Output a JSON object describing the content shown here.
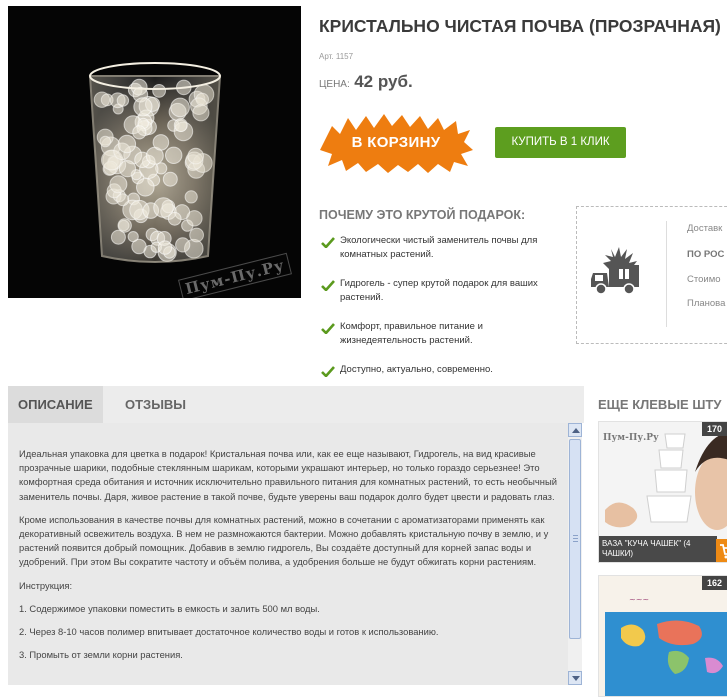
{
  "product": {
    "title": "КРИСТАЛЬНО ЧИСТАЯ ПОЧВА (ПРОЗРАЧНАЯ)",
    "article": "Арт. 1157",
    "price_label": "ЦЕНА:",
    "price_value": "42 руб.",
    "watermark": "Пум-Пу.Ру"
  },
  "actions": {
    "cart_label": "В КОРЗИНУ",
    "buy_one_click_label": "КУПИТЬ В 1 КЛИК"
  },
  "why": {
    "heading": "ПОЧЕМУ ЭТО КРУТОЙ ПОДАРОК:",
    "items": [
      "Экологически чистый заменитель почвы для комнатных растений.",
      "Гидрогель - супер крутой подарок для ваших растений.",
      "Комфорт, правильное питание и жизнедеятельность растений.",
      "Доступно, актуально, современно."
    ]
  },
  "delivery": {
    "lines": [
      "Доставк",
      "ПО РОС",
      "Стоимо",
      "Планова"
    ]
  },
  "tabs": [
    {
      "label": "ОПИСАНИЕ",
      "active": true
    },
    {
      "label": "ОТЗЫВЫ",
      "active": false
    }
  ],
  "description": {
    "paragraphs": [
      "Идеальная упаковка для цветка в подарок! Кристальная почва или, как ее еще называют, Гидрогель, на вид красивые прозрачные шарики, подобные стеклянным шарикам, которыми украшают интерьер, но только гораздо серьезнее! Это комфортная среда обитания и источник исключительно правильного питания для комнатных растений, то есть необычный заменитель почвы.  Даря, живое растение в такой почве, будьте уверены ваш подарок долго будет цвести и радовать глаз.",
      "Кроме использования в качестве почвы для комнатных растений, можно в сочетании с ароматизаторами применять как декоративный освежитель воздуха. В нем не размножаются бактерии. Можно добавлять кристальную почву в землю, и у растений появится добрый помощник. Добавив в землю гидрогель, Вы создаёте доступный для корней запас воды и удобрений. При этом Вы сократите частоту и объём полива, а удобрения больше не будут обжигать корни растениям.",
      "Инструкция:",
      "1. Содержимое упаковки поместить в емкость и залить 500 мл воды.",
      "2. Через 8-10 часов полимер впитывает достаточное количество воды и готов к использованию.",
      "3. Промыть от земли корни растения."
    ]
  },
  "more": {
    "heading": "ЕЩЕ КЛЕВЫЕ ШТУ",
    "items": [
      {
        "name": "ВАЗА \"КУЧА ЧАШЕК\" (4 ЧАШКИ)",
        "count": "170",
        "watermark": "Пум-Пу.Ру"
      },
      {
        "name": "",
        "count": "162",
        "watermark": ""
      }
    ]
  },
  "colors": {
    "cart_orange": "#ee7d10",
    "buy_green": "#5d9e1f",
    "check_green": "#5b9a1e"
  }
}
